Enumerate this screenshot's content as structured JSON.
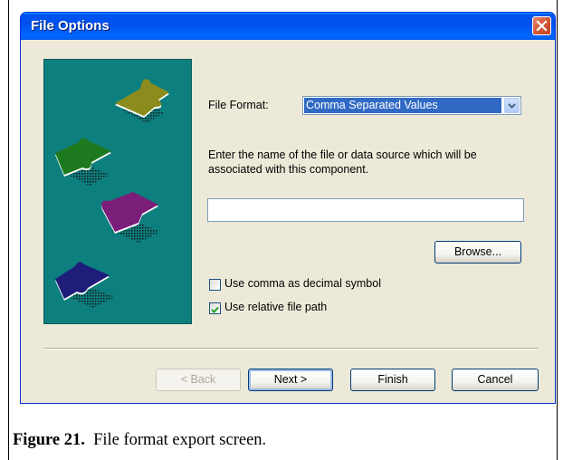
{
  "window": {
    "title": "File Options"
  },
  "form": {
    "file_format_label": "File Format:",
    "file_format_value": "Comma Separated Values",
    "instruction_line1": "Enter the name of the file or data source which will be",
    "instruction_line2": "associated with this component.",
    "file_name_value": "",
    "browse_label": "Browse...",
    "comma_decimal_label": "Use comma as decimal symbol",
    "comma_decimal_checked": false,
    "relative_path_label": "Use relative file path",
    "relative_path_checked": true
  },
  "buttons": {
    "back": "< Back",
    "next": "Next >",
    "finish": "Finish",
    "cancel": "Cancel"
  },
  "caption": {
    "prefix": "Figure 21.",
    "text": "File format export screen."
  },
  "illustration": {
    "background": "#0e7f7f",
    "pieces": [
      "olive",
      "green",
      "purple",
      "navy"
    ]
  }
}
